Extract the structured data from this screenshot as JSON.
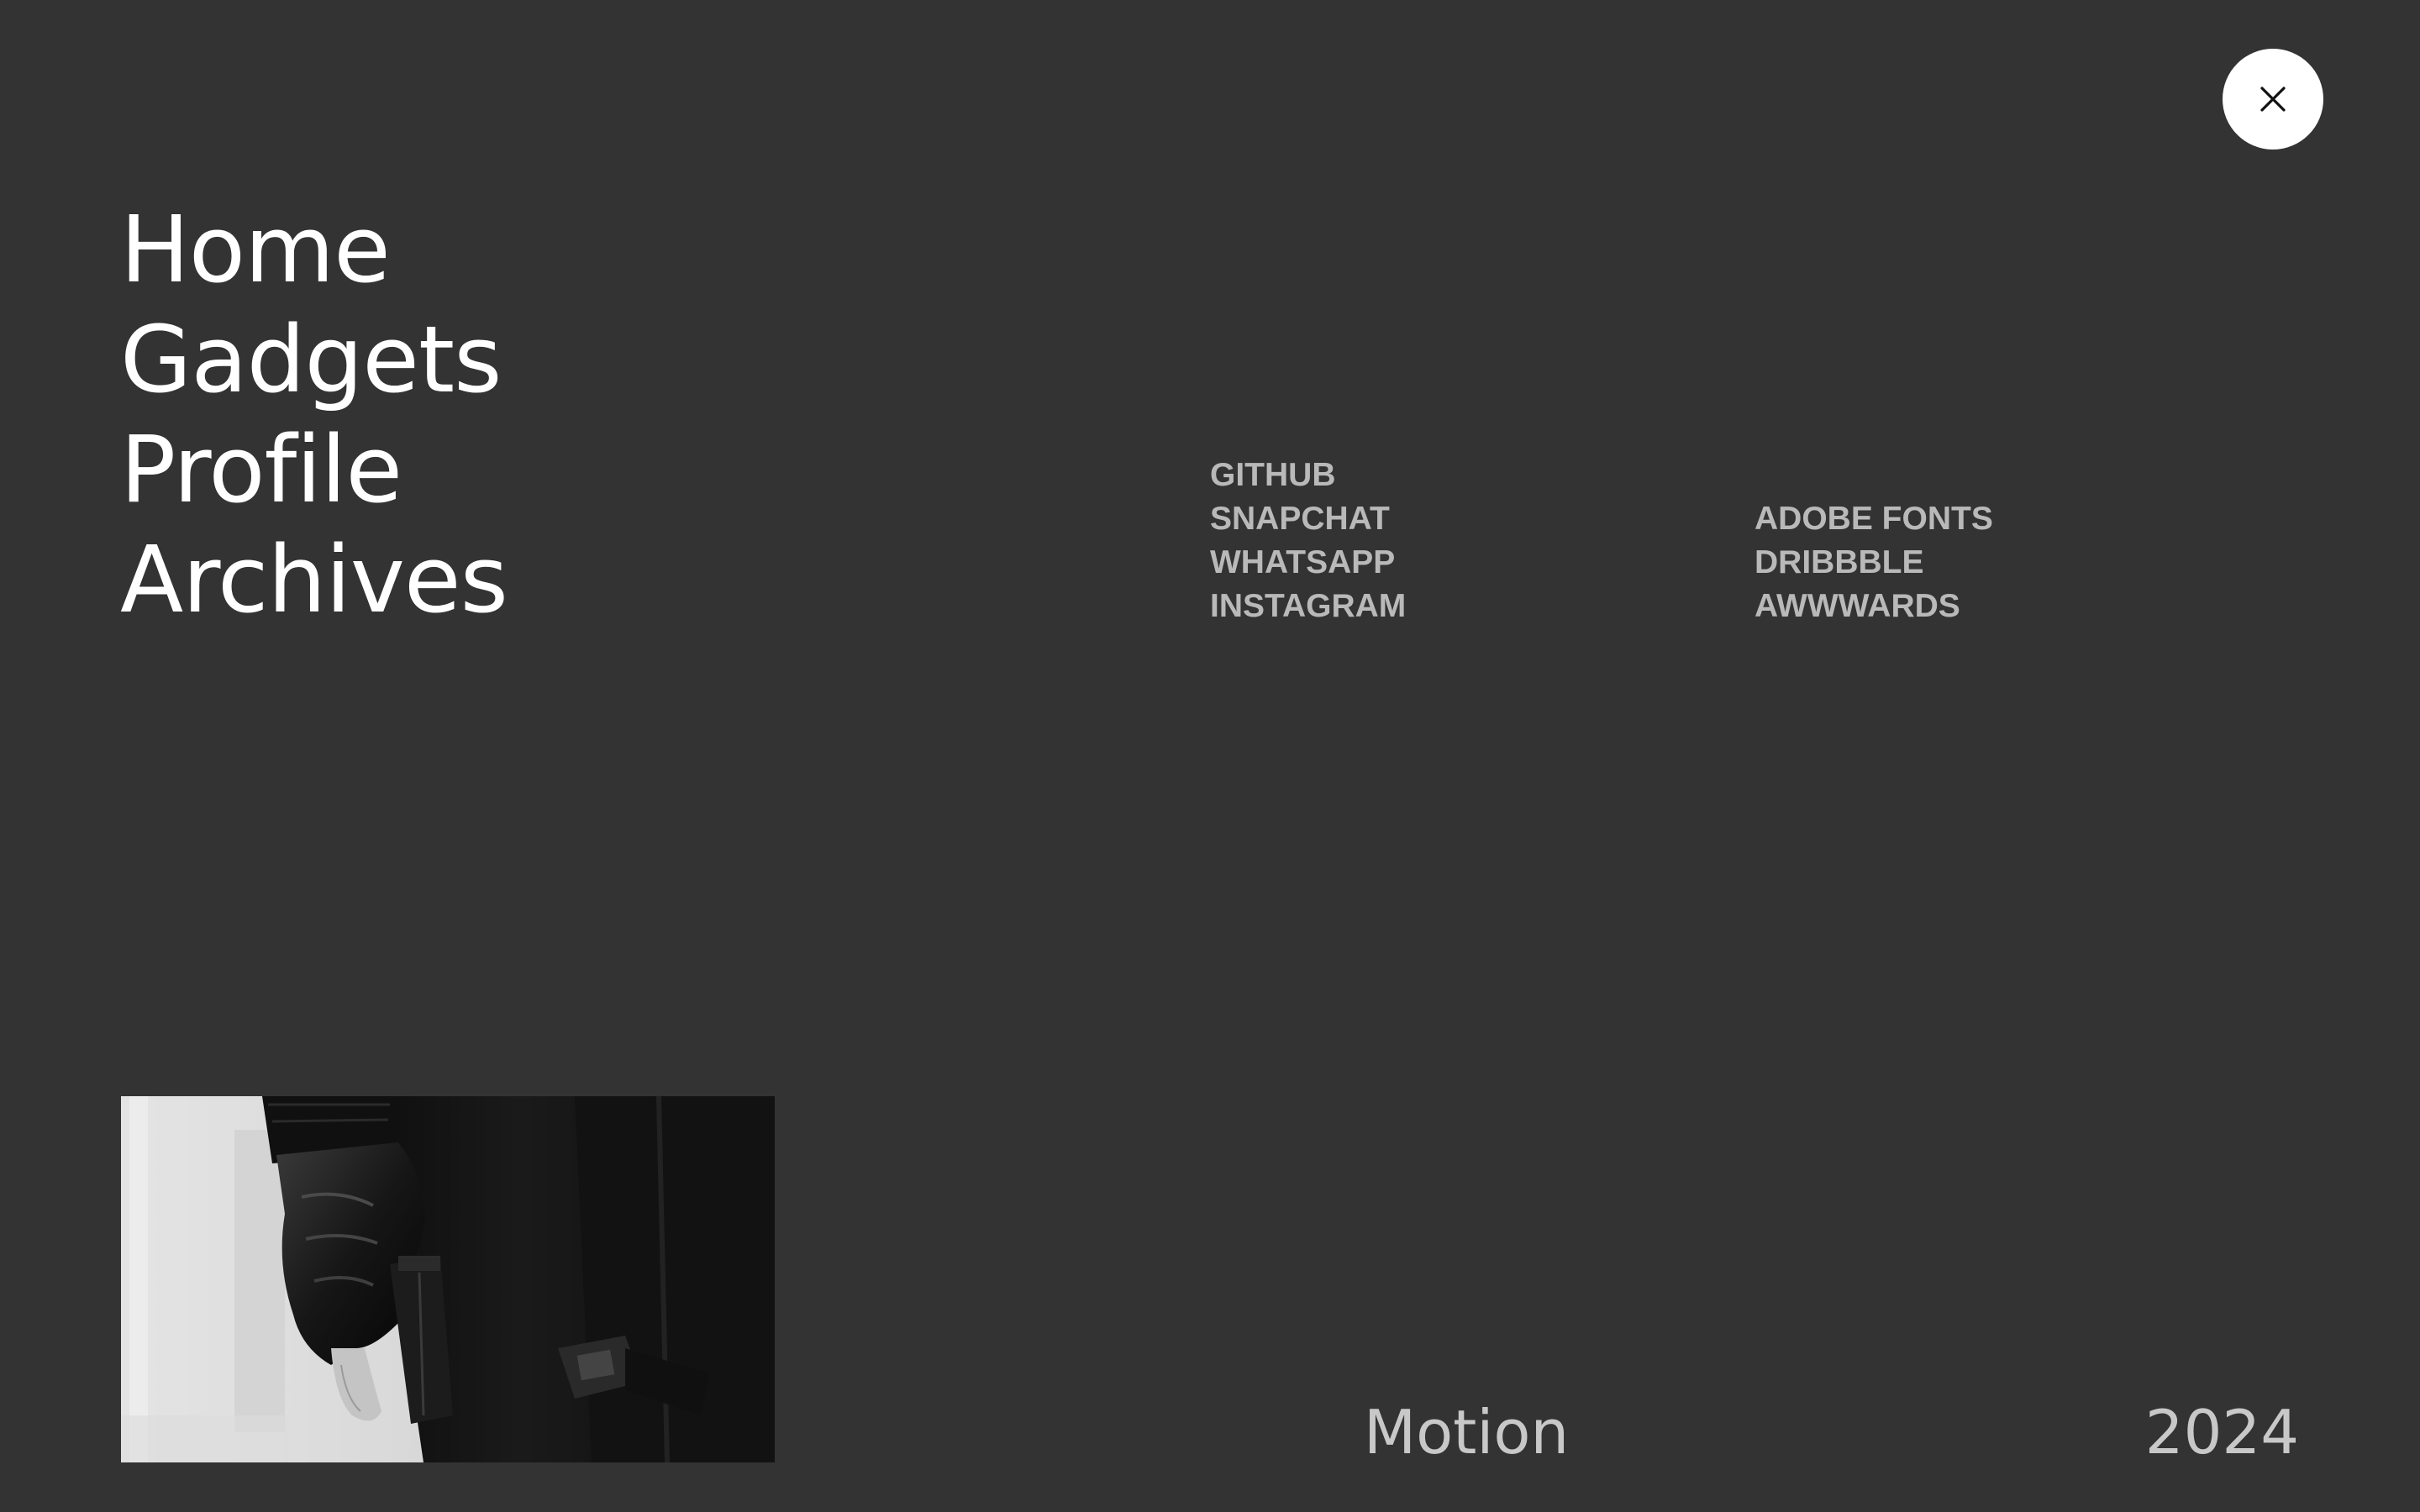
{
  "close_button": {
    "icon": "close-icon"
  },
  "main_nav": {
    "items": [
      {
        "label": "Home"
      },
      {
        "label": "Gadgets"
      },
      {
        "label": "Profile"
      },
      {
        "label": "Archives"
      }
    ]
  },
  "social_links": {
    "column_1": [
      {
        "label": "GITHUB"
      },
      {
        "label": "SNAPCHAT"
      },
      {
        "label": "WHATSAPP"
      },
      {
        "label": "INSTAGRAM"
      }
    ],
    "column_2": [
      {
        "label": "ADOBE FONTS"
      },
      {
        "label": "DRIBBBLE"
      },
      {
        "label": "AWWWARDS"
      }
    ]
  },
  "footer": {
    "word": "Motion",
    "year": "2024"
  },
  "colors": {
    "background": "#333333",
    "nav_text": "#ffffff",
    "link_text": "#b9b9b9",
    "footer_text": "#c8c8c8",
    "close_button_bg": "#ffffff"
  }
}
